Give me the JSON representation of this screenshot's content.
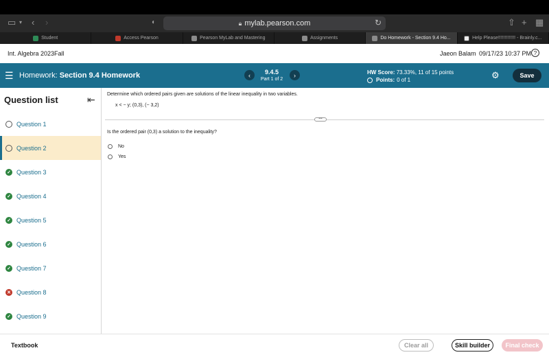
{
  "browser": {
    "url": "mylab.pearson.com",
    "tabs": [
      {
        "label": "Student",
        "active": false
      },
      {
        "label": "Access Pearson",
        "active": false
      },
      {
        "label": "Pearson MyLab and Mastering",
        "active": false
      },
      {
        "label": "Assignments",
        "active": false
      },
      {
        "label": "Do Homework - Section 9.4 Ho...",
        "active": true
      },
      {
        "label": "Help Please!!!!!!!!!!!!! - Brainly.c...",
        "active": false
      }
    ]
  },
  "course": {
    "name": "Int. Algebra 2023Fall",
    "user": "Jaeon Balam",
    "datetime": "09/17/23 10:37 PM",
    "help_glyph": "?"
  },
  "header": {
    "homework_label": "Homework:",
    "homework_title": "Section 9.4 Homework",
    "question_number": "9.4.5",
    "part": "Part 1 of 2",
    "hw_score_label": "HW Score:",
    "hw_score_value": "73.33%, 11 of 15 points",
    "points_label": "Points:",
    "points_value": "0 of 1",
    "save_label": "Save",
    "prev_glyph": "‹",
    "next_glyph": "›"
  },
  "sidebar": {
    "title": "Question list",
    "questions": [
      {
        "label": "Question 1",
        "status": "empty"
      },
      {
        "label": "Question 2",
        "status": "empty"
      },
      {
        "label": "Question 3",
        "status": "correct"
      },
      {
        "label": "Question 4",
        "status": "correct"
      },
      {
        "label": "Question 5",
        "status": "correct"
      },
      {
        "label": "Question 6",
        "status": "correct"
      },
      {
        "label": "Question 7",
        "status": "correct"
      },
      {
        "label": "Question 8",
        "status": "wrong"
      },
      {
        "label": "Question 9",
        "status": "correct"
      }
    ]
  },
  "content": {
    "prompt": "Determine which ordered pairs given are solutions of the linear inequality in two variables.",
    "inequality": "x < − y;  (0,3), (− 3,2)",
    "question": "Is the ordered pair (0,3) a solution to the inequality?",
    "options": [
      "No",
      "Yes"
    ]
  },
  "footer": {
    "textbook": "Textbook",
    "clear_all": "Clear all",
    "skill_builder": "Skill builder",
    "final_check": "Final check"
  },
  "colors": {
    "header_blue": "#1b6e8e",
    "save_dark": "#132f3d",
    "active_question_bg": "#fbeccb",
    "correct_green": "#2e8540",
    "wrong_red": "#c0392b",
    "final_check_disabled": "#f2c4c9"
  }
}
